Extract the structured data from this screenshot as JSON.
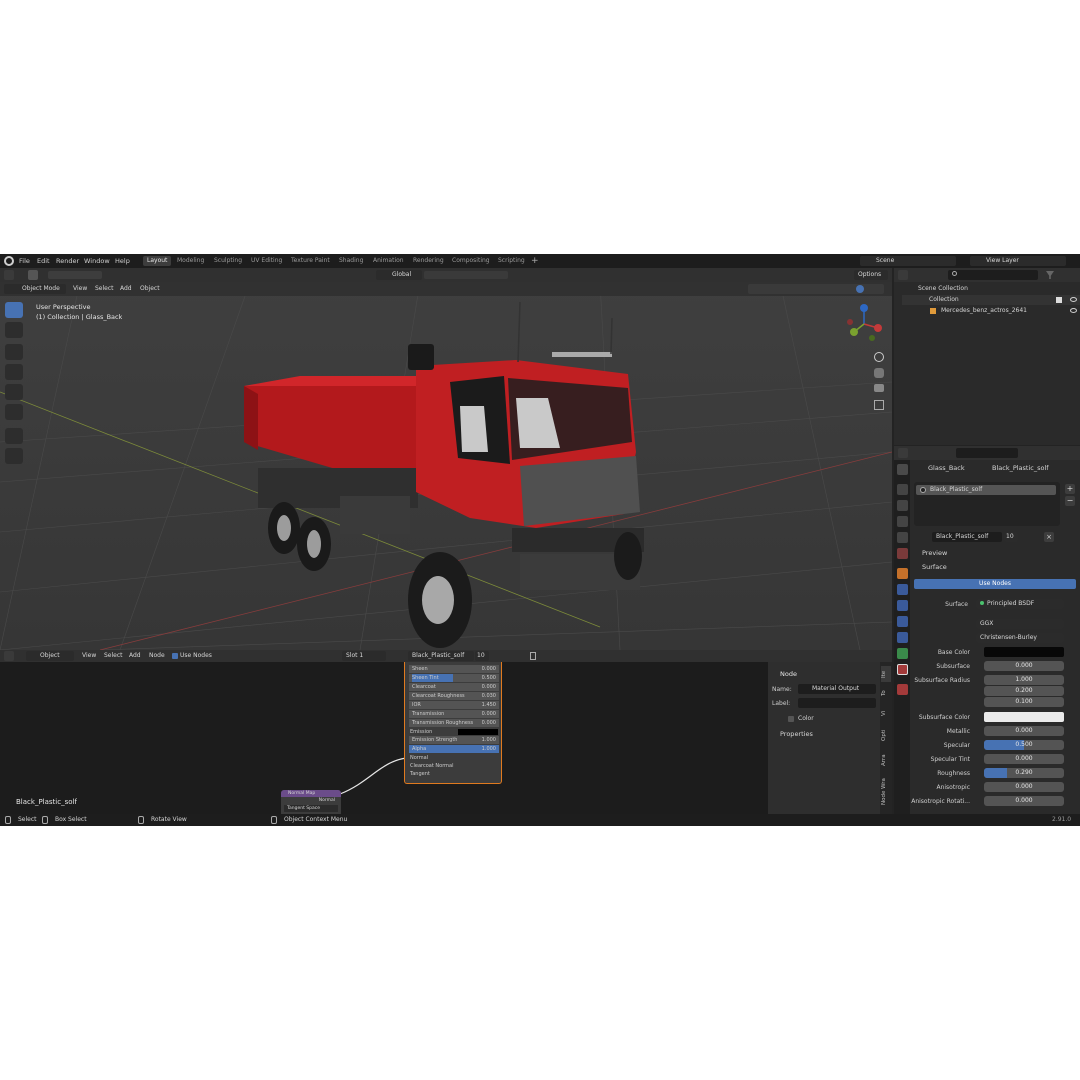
{
  "menu": {
    "items": [
      "File",
      "Edit",
      "Render",
      "Window",
      "Help"
    ]
  },
  "workspaces": [
    "Layout",
    "Modeling",
    "Sculpting",
    "UV Editing",
    "Texture Paint",
    "Shading",
    "Animation",
    "Rendering",
    "Compositing",
    "Scripting"
  ],
  "active_workspace": "Layout",
  "scene_name": "Scene",
  "view_layer": "View Layer",
  "header": {
    "transform": "Global",
    "options": "Options",
    "mode": "Object Mode",
    "view": "View",
    "select": "Select",
    "add": "Add",
    "object": "Object"
  },
  "viewport": {
    "perspective": "User Perspective",
    "collection_info": "(1) Collection | Glass_Back"
  },
  "outliner": {
    "scene_collection": "Scene Collection",
    "collection": "Collection",
    "object": "Mercedes_benz_actros_2641"
  },
  "properties": {
    "object_name": "Glass_Back",
    "material_name": "Black_Plastic_solf",
    "slot_item": "Black_Plastic_solf",
    "material_field": "Black_Plastic_solf",
    "users": "10",
    "preview": "Preview",
    "surface_panel": "Surface",
    "use_nodes": "Use Nodes",
    "surface_label": "Surface",
    "surface_value": "Principled BSDF",
    "distribution": "GGX",
    "subsurface_method": "Christensen-Burley",
    "base_color_label": "Base Color",
    "subsurface_label": "Subsurface",
    "subsurface_value": "0.000",
    "subsurface_radius_label": "Subsurface Radius",
    "subsurface_radius": [
      "1.000",
      "0.200",
      "0.100"
    ],
    "subsurface_color_label": "Subsurface Color",
    "metallic_label": "Metallic",
    "metallic_value": "0.000",
    "specular_label": "Specular",
    "specular_value": "0.500",
    "specular_fill": 0.5,
    "specular_tint_label": "Specular Tint",
    "specular_tint_value": "0.000",
    "roughness_label": "Roughness",
    "roughness_value": "0.290",
    "roughness_fill": 0.29,
    "anisotropic_label": "Anisotropic",
    "anisotropic_value": "0.000",
    "anisotropic_rot_label": "Anisotropic Rotati...",
    "anisotropic_rot_value": "0.000"
  },
  "node_editor": {
    "editor_type": "Object",
    "view": "View",
    "select": "Select",
    "add": "Add",
    "node": "Node",
    "use_nodes": "Use Nodes",
    "slot": "Slot 1",
    "material": "Black_Plastic_solf",
    "users": "10",
    "material_label": "Black_Plastic_solf",
    "bsdf_rows": [
      {
        "label": "Sheen",
        "value": "0.000"
      },
      {
        "label": "Sheen Tint",
        "value": "0.500"
      },
      {
        "label": "Clearcoat",
        "value": "0.000"
      },
      {
        "label": "Clearcoat Roughness",
        "value": "0.030"
      },
      {
        "label": "IOR",
        "value": "1.450"
      },
      {
        "label": "Transmission",
        "value": "0.000"
      },
      {
        "label": "Transmission Roughness",
        "value": "0.000"
      }
    ],
    "emission_label": "Emission",
    "emission_strength_label": "Emission Strength",
    "emission_strength_value": "1.000",
    "alpha_label": "Alpha",
    "alpha_value": "1.000",
    "normal_label": "Normal",
    "clearcoat_normal_label": "Clearcoat Normal",
    "tangent_label": "Tangent",
    "normalmap_title": "Normal Map",
    "normalmap_output": "Normal",
    "normalmap_space": "Tangent Space"
  },
  "node_panel": {
    "title": "Node",
    "name_label": "Name:",
    "name_value": "Material Output",
    "label_label": "Label:",
    "color": "Color",
    "properties": "Properties"
  },
  "side_tabs": [
    "Ite",
    "To",
    "Vi",
    "Opti",
    "Arra",
    "Node Wra"
  ],
  "status": {
    "select": "Select",
    "box_select": "Box Select",
    "rotate_view": "Rotate View",
    "context_menu": "Object Context Menu",
    "version": "2.91.0"
  },
  "colors": {
    "accent_blue": "#4772b3",
    "truck_red": "#b3191c",
    "node_purple": "#6b4c8a"
  }
}
